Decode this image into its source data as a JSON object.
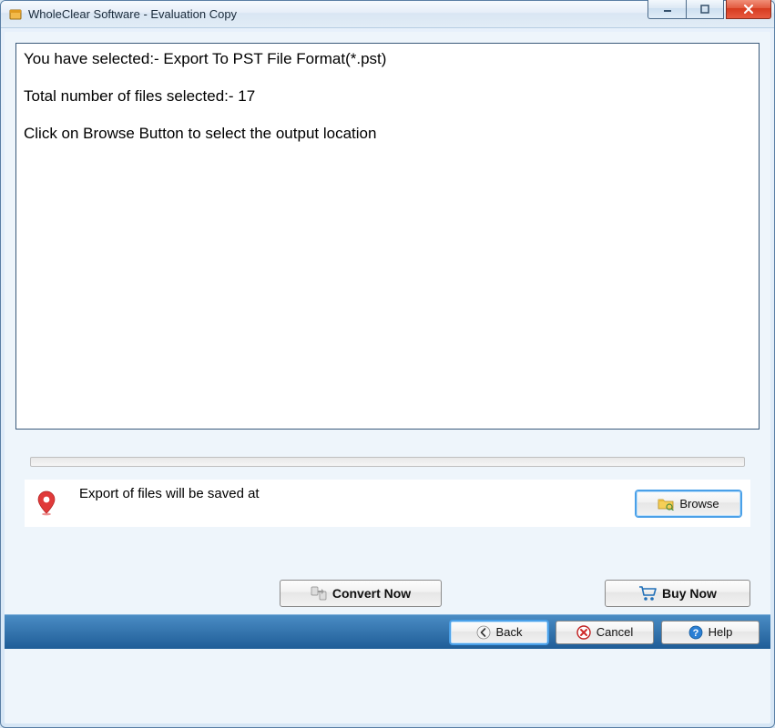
{
  "window": {
    "title": "WholeClear Software - Evaluation Copy"
  },
  "info": {
    "line1": "You have selected:- Export To PST File Format(*.pst)",
    "line2": "Total number of files selected:- 17",
    "line3": "Click on Browse Button to select the output location"
  },
  "save": {
    "label": "Export of files will be saved at",
    "browse_label": "Browse"
  },
  "actions": {
    "convert_label": "Convert Now",
    "buynow_label": "Buy Now"
  },
  "footer": {
    "back_label": "Back",
    "cancel_label": "Cancel",
    "help_label": "Help"
  }
}
